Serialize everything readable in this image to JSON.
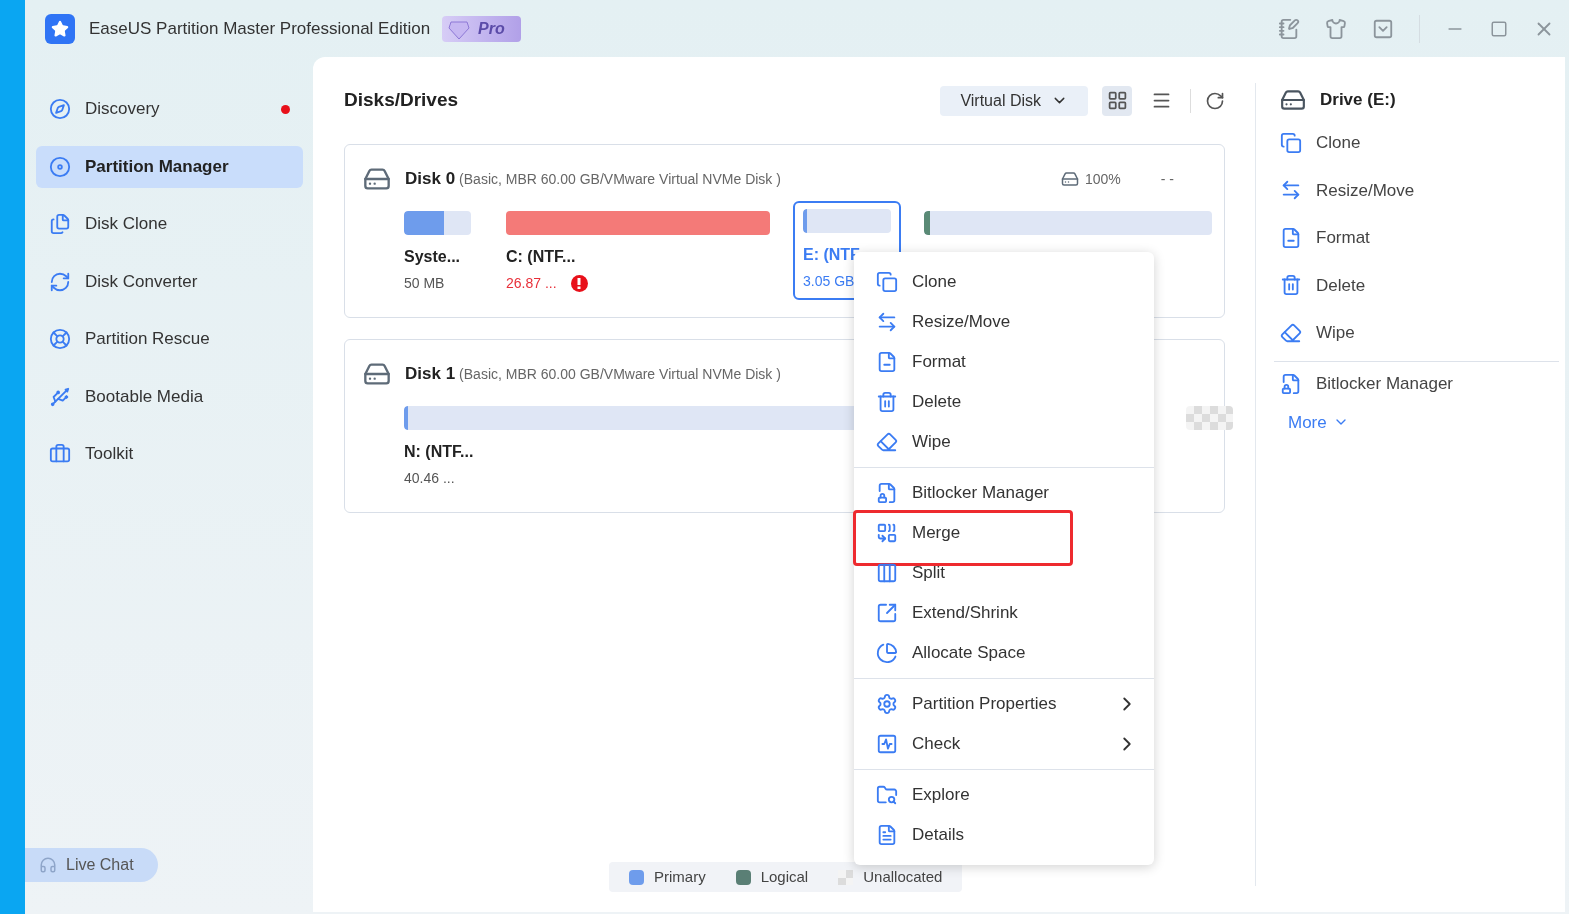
{
  "window": {
    "title": "EaseUS Partition Master Professional Edition",
    "badge": "Pro"
  },
  "sidebar": {
    "items": [
      {
        "label": "Discovery",
        "selected": false,
        "alert": true
      },
      {
        "label": "Partition Manager",
        "selected": true,
        "alert": false
      },
      {
        "label": "Disk Clone",
        "selected": false,
        "alert": false
      },
      {
        "label": "Disk Converter",
        "selected": false,
        "alert": false
      },
      {
        "label": "Partition Rescue",
        "selected": false,
        "alert": false
      },
      {
        "label": "Bootable Media",
        "selected": false,
        "alert": false
      },
      {
        "label": "Toolkit",
        "selected": false,
        "alert": false
      }
    ],
    "live_chat": "Live Chat"
  },
  "main": {
    "title": "Disks/Drives",
    "disk_type": "Virtual Disk",
    "views": [
      {
        "kind": "grid",
        "selected": true
      },
      {
        "kind": "list",
        "selected": false
      }
    ],
    "disks": [
      {
        "name": "Disk 0",
        "info": "(Basic, MBR 60.00 GB/VMware Virtual NVMe Disk )",
        "health": "100%",
        "temp": "- -",
        "partitions": [
          {
            "name": "Syste...",
            "size": "50 MB",
            "level": 0.6,
            "color": "#6e9cec",
            "selected": false,
            "warning": false
          },
          {
            "name": "C: (NTF...",
            "size": "26.87 ...",
            "level": 1,
            "color": "#f47a78",
            "selected": false,
            "warning": true
          },
          {
            "name": "E: (NTF",
            "size": "3.05 GB",
            "level": 0.05,
            "color": "#6e9cec",
            "selected": true,
            "warning": false
          },
          {
            "level": 0.02,
            "color": "#5a8a76",
            "selected": false
          }
        ]
      },
      {
        "name": "Disk 1",
        "info": "(Basic, MBR 60.00 GB/VMware Virtual NVMe Disk )",
        "partitions": [
          {
            "name": "N: (NTF...",
            "size": "40.46 ...",
            "level": 0.005,
            "color": "#6e9cec",
            "selected": false,
            "warning": false
          },
          {
            "kind": "unallocated",
            "selected": false
          }
        ]
      }
    ],
    "legend": [
      {
        "label": "Primary",
        "color": "#6e9cec"
      },
      {
        "label": "Logical",
        "color": "#5a7f75"
      },
      {
        "label": "Unallocated",
        "kind": "unallocated"
      }
    ]
  },
  "context_menu": {
    "groups": [
      [
        {
          "label": "Clone",
          "highlighted": false,
          "submenu": false
        },
        {
          "label": "Resize/Move",
          "highlighted": false,
          "submenu": false
        },
        {
          "label": "Format",
          "highlighted": false,
          "submenu": false
        },
        {
          "label": "Delete",
          "highlighted": false,
          "submenu": false
        },
        {
          "label": "Wipe",
          "highlighted": false,
          "submenu": false
        }
      ],
      [
        {
          "label": "Bitlocker Manager",
          "highlighted": false,
          "submenu": false
        },
        {
          "label": "Merge",
          "highlighted": true,
          "submenu": false
        },
        {
          "label": "Split",
          "highlighted": false,
          "submenu": false
        },
        {
          "label": "Extend/Shrink",
          "highlighted": false,
          "submenu": false
        },
        {
          "label": "Allocate Space",
          "highlighted": false,
          "submenu": false
        }
      ],
      [
        {
          "label": "Partition Properties",
          "highlighted": false,
          "submenu": true
        },
        {
          "label": "Check",
          "highlighted": false,
          "submenu": true
        }
      ],
      [
        {
          "label": "Explore",
          "highlighted": false,
          "submenu": false
        },
        {
          "label": "Details",
          "highlighted": false,
          "submenu": false
        }
      ]
    ]
  },
  "details_panel": {
    "title": "Drive (E:)",
    "actions": [
      "Clone",
      "Resize/Move",
      "Format",
      "Delete",
      "Wipe"
    ],
    "extra_actions": [
      "Bitlocker Manager"
    ],
    "more": "More"
  }
}
